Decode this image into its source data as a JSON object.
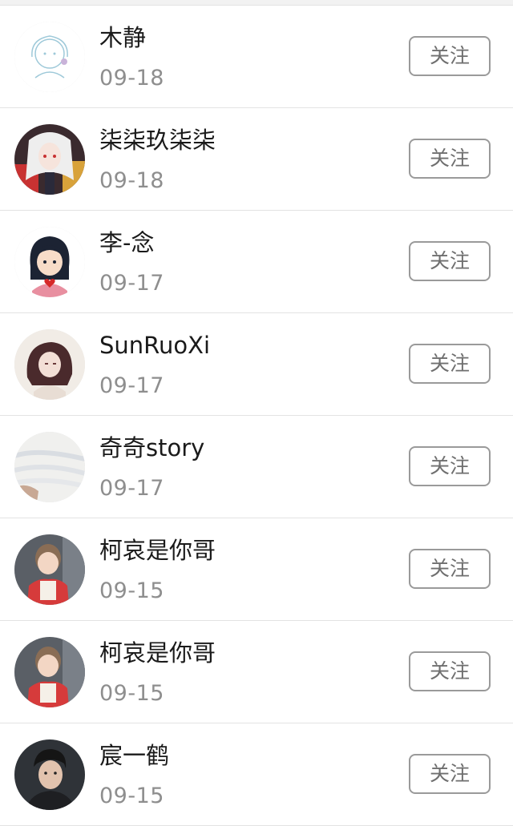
{
  "follow_label": "关注",
  "rows": [
    {
      "name": "木静",
      "date": "09-18",
      "avatar": "sketch-girl-avatar-icon"
    },
    {
      "name": "柒柒玖柒柒",
      "date": "09-18",
      "avatar": "anime-white-hair-avatar-icon"
    },
    {
      "name": "李-念",
      "date": "09-17",
      "avatar": "cartoon-girl-heart-avatar-icon"
    },
    {
      "name": "SunRuoXi",
      "date": "09-17",
      "avatar": "anime-dark-hair-avatar-icon"
    },
    {
      "name": "奇奇story",
      "date": "09-17",
      "avatar": "photo-fabric-avatar-icon"
    },
    {
      "name": "柯哀是你哥",
      "date": "09-15",
      "avatar": "child-photo-avatar-icon"
    },
    {
      "name": "柯哀是你哥",
      "date": "09-15",
      "avatar": "child-photo-avatar-icon"
    },
    {
      "name": "宸一鹤",
      "date": "09-15",
      "avatar": "boy-photo-avatar-icon"
    }
  ]
}
